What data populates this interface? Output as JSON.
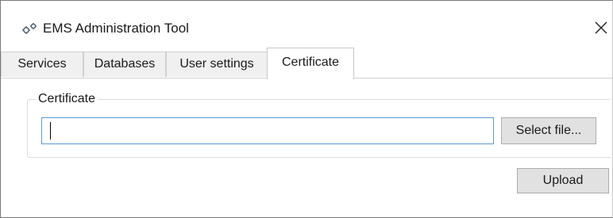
{
  "window": {
    "title": "EMS Administration Tool",
    "icon": "gears-icon",
    "close_icon": "close-icon"
  },
  "tabs": [
    {
      "label": "Services",
      "active": false
    },
    {
      "label": "Databases",
      "active": false
    },
    {
      "label": "User settings",
      "active": false
    },
    {
      "label": "Certificate",
      "active": true
    }
  ],
  "certificate": {
    "group_label": "Certificate",
    "file_input": {
      "value": "",
      "placeholder": ""
    },
    "select_file_label": "Select file...",
    "upload_label": "Upload"
  },
  "colors": {
    "input_focus_border": "#5b9bd5",
    "button_face": "#e1e1e1",
    "tab_inactive": "#f0f0f0"
  }
}
